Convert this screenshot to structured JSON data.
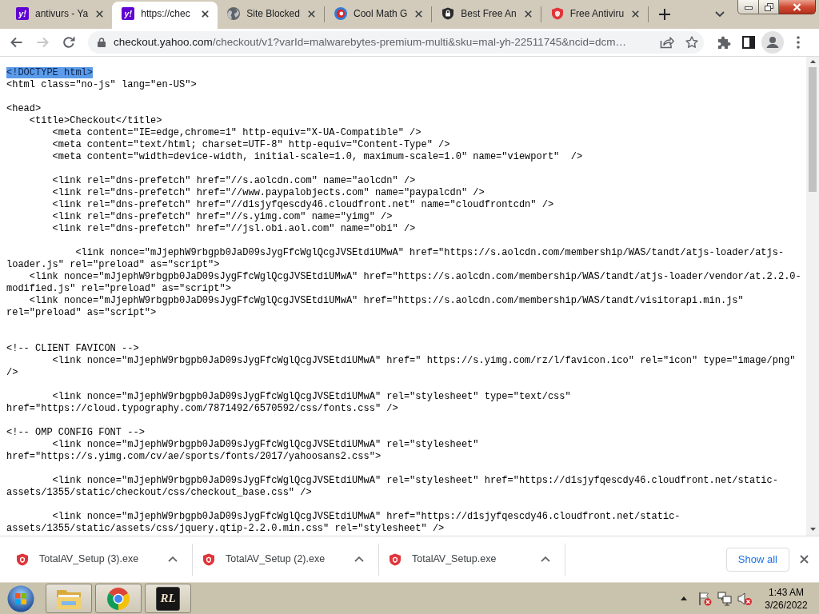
{
  "tabs": [
    {
      "kind": "yahoo",
      "logo": "y!",
      "title": "antivurs - Ya",
      "selected": false
    },
    {
      "kind": "yahoo",
      "logo": "y!",
      "title": "https://chec",
      "selected": true
    },
    {
      "kind": "globe",
      "title": "Site Blocked",
      "selected": false
    },
    {
      "kind": "math",
      "title": "Cool Math G",
      "selected": false
    },
    {
      "kind": "badge",
      "title": "Best Free An",
      "selected": false
    },
    {
      "kind": "shield",
      "title": "Free Antiviru",
      "selected": false
    }
  ],
  "toolbar": {
    "nav": [
      {
        "kind": "back",
        "disabled": false
      },
      {
        "kind": "forward",
        "disabled": true
      },
      {
        "kind": "reload",
        "disabled": false
      }
    ],
    "address": {
      "host": "checkout.yahoo.com",
      "path": "/checkout/v1?varId=malwarebytes-premium-multi&sku=mal-yh-22511745&ncid=dcm…"
    }
  },
  "source": {
    "lines": [
      {
        "kind": "code",
        "text": "<!DOCTYPE html>",
        "selected": true
      },
      {
        "kind": "code",
        "text": "<html class=\"no-js\" lang=\"en-US\">",
        "selected": false
      },
      {
        "kind": "blank"
      },
      {
        "kind": "code",
        "text": "<head>",
        "selected": false
      },
      {
        "kind": "code",
        "text": "    <title>Checkout</title>",
        "selected": false
      },
      {
        "kind": "code",
        "text": "        <meta content=\"IE=edge,chrome=1\" http-equiv=\"X-UA-Compatible\" />",
        "selected": false
      },
      {
        "kind": "code",
        "text": "        <meta content=\"text/html; charset=UTF-8\" http-equiv=\"Content-Type\" />",
        "selected": false
      },
      {
        "kind": "code",
        "text": "        <meta content=\"width=device-width, initial-scale=1.0, maximum-scale=1.0\" name=\"viewport\"  />",
        "selected": false
      },
      {
        "kind": "blank"
      },
      {
        "kind": "code",
        "text": "        <link rel=\"dns-prefetch\" href=\"//s.aolcdn.com\" name=\"aolcdn\" />",
        "selected": false
      },
      {
        "kind": "code",
        "text": "        <link rel=\"dns-prefetch\" href=\"//www.paypalobjects.com\" name=\"paypalcdn\" />",
        "selected": false
      },
      {
        "kind": "code",
        "text": "        <link rel=\"dns-prefetch\" href=\"//d1sjyfqescdy46.cloudfront.net\" name=\"cloudfrontcdn\" />",
        "selected": false
      },
      {
        "kind": "code",
        "text": "        <link rel=\"dns-prefetch\" href=\"//s.yimg.com\" name=\"yimg\" />",
        "selected": false
      },
      {
        "kind": "code",
        "text": "        <link rel=\"dns-prefetch\" href=\"//jsl.obi.aol.com\" name=\"obi\" />",
        "selected": false
      },
      {
        "kind": "blank"
      },
      {
        "kind": "code",
        "text": "            <link nonce=\"mJjephW9rbgpb0JaD09sJygFfcWglQcgJVSEtdiUMwA\" href=\"https://s.aolcdn.com/membership/WAS/tandt/atjs-loader/atjs-",
        "selected": false
      },
      {
        "kind": "code",
        "text": "loader.js\" rel=\"preload\" as=\"script\">",
        "selected": false
      },
      {
        "kind": "code",
        "text": "    <link nonce=\"mJjephW9rbgpb0JaD09sJygFfcWglQcgJVSEtdiUMwA\" href=\"https://s.aolcdn.com/membership/WAS/tandt/atjs-loader/vendor/at.2.2.0-",
        "selected": false
      },
      {
        "kind": "code",
        "text": "modified.js\" rel=\"preload\" as=\"script\">",
        "selected": false
      },
      {
        "kind": "code",
        "text": "    <link nonce=\"mJjephW9rbgpb0JaD09sJygFfcWglQcgJVSEtdiUMwA\" href=\"https://s.aolcdn.com/membership/WAS/tandt/visitorapi.min.js\"",
        "selected": false
      },
      {
        "kind": "code",
        "text": "rel=\"preload\" as=\"script\">",
        "selected": false
      },
      {
        "kind": "blank"
      },
      {
        "kind": "blank"
      },
      {
        "kind": "code",
        "text": "<!-- CLIENT FAVICON -->",
        "selected": false
      },
      {
        "kind": "code",
        "text": "        <link nonce=\"mJjephW9rbgpb0JaD09sJygFfcWglQcgJVSEtdiUMwA\" href=\" https://s.yimg.com/rz/l/favicon.ico\" rel=\"icon\" type=\"image/png\"",
        "selected": false
      },
      {
        "kind": "code",
        "text": "/>",
        "selected": false
      },
      {
        "kind": "blank"
      },
      {
        "kind": "code",
        "text": "        <link nonce=\"mJjephW9rbgpb0JaD09sJygFfcWglQcgJVSEtdiUMwA\" rel=\"stylesheet\" type=\"text/css\"",
        "selected": false
      },
      {
        "kind": "code",
        "text": "href=\"https://cloud.typography.com/7871492/6570592/css/fonts.css\" />",
        "selected": false
      },
      {
        "kind": "blank"
      },
      {
        "kind": "code",
        "text": "<!-- OMP CONFIG FONT -->",
        "selected": false
      },
      {
        "kind": "code",
        "text": "        <link nonce=\"mJjephW9rbgpb0JaD09sJygFfcWglQcgJVSEtdiUMwA\" rel=\"stylesheet\"",
        "selected": false
      },
      {
        "kind": "code",
        "text": "href=\"https://s.yimg.com/cv/ae/sports/fonts/2017/yahoosans2.css\">",
        "selected": false
      },
      {
        "kind": "blank"
      },
      {
        "kind": "code",
        "text": "        <link nonce=\"mJjephW9rbgpb0JaD09sJygFfcWglQcgJVSEtdiUMwA\" rel=\"stylesheet\" href=\"https://d1sjyfqescdy46.cloudfront.net/static-",
        "selected": false
      },
      {
        "kind": "code",
        "text": "assets/1355/static/checkout/css/checkout_base.css\" />",
        "selected": false
      },
      {
        "kind": "blank"
      },
      {
        "kind": "code",
        "text": "        <link nonce=\"mJjephW9rbgpb0JaD09sJygFfcWglQcgJVSEtdiUMwA\" href=\"https://d1sjyfqescdy46.cloudfront.net/static-",
        "selected": false
      },
      {
        "kind": "code",
        "text": "assets/1355/static/assets/css/jquery.qtip-2.2.0.min.css\" rel=\"stylesheet\" />",
        "selected": false
      }
    ]
  },
  "downloads": {
    "items": [
      {
        "name": "TotalAV_Setup (3).exe"
      },
      {
        "name": "TotalAV_Setup (2).exe"
      },
      {
        "name": "TotalAV_Setup.exe"
      }
    ],
    "show_all": "Show all"
  },
  "taskbar": {
    "apps": [
      {
        "kind": "folder"
      },
      {
        "kind": "browser"
      },
      {
        "kind": "game",
        "logo": "RL"
      }
    ],
    "clock": {
      "time": "1:43 AM",
      "date": "3/26/2022"
    }
  }
}
